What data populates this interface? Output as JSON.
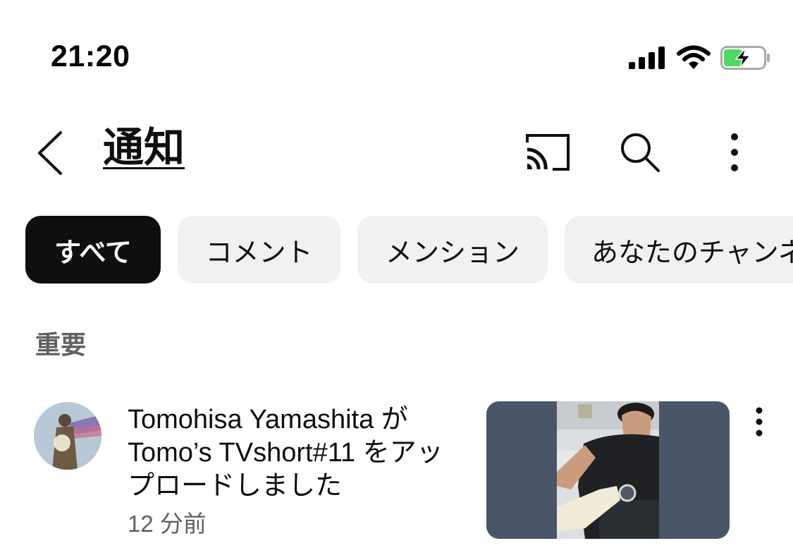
{
  "status_bar": {
    "time": "21:20",
    "icons": [
      "signal-icon",
      "wifi-icon",
      "battery-charging-icon"
    ]
  },
  "header": {
    "title": "通知",
    "actions": [
      "back-icon",
      "cast-icon",
      "search-icon",
      "more-vert-icon"
    ]
  },
  "chips": [
    {
      "label": "すべて",
      "active": true
    },
    {
      "label": "コメント",
      "active": false
    },
    {
      "label": "メンション",
      "active": false
    },
    {
      "label": "あなたのチャンネル",
      "active": false
    }
  ],
  "section": {
    "label": "重要"
  },
  "notification": {
    "text": "Tomohisa Yamashita が Tomo’s TVshort#11 をアップロードしました",
    "time": "12 分前"
  },
  "colors": {
    "chip_active_bg": "#0f0f0f",
    "chip_bg": "#f1f1f1",
    "secondary_text": "#606060",
    "battery_green": "#4cd964"
  }
}
